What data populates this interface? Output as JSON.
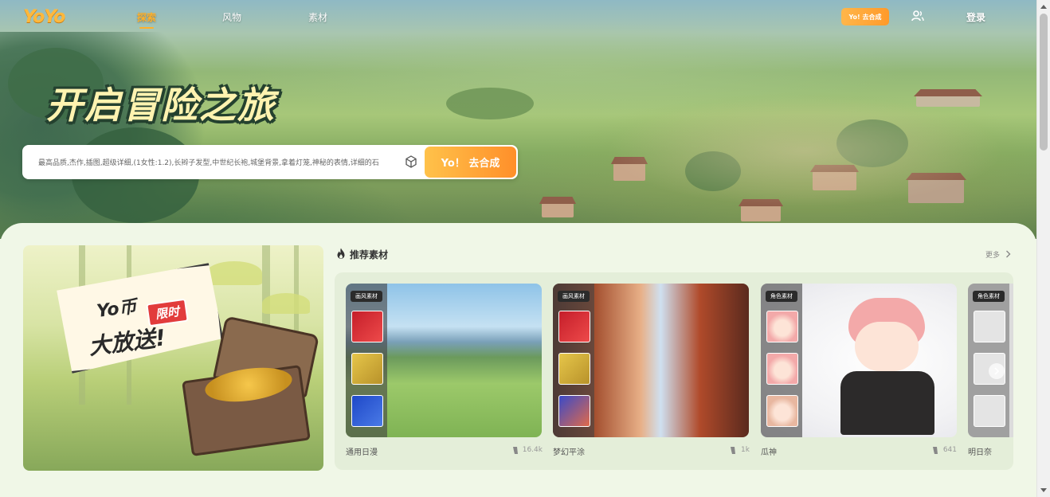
{
  "nav": {
    "logo": "YoYo",
    "links": [
      "探索",
      "风物",
      "素材"
    ],
    "active_index": 0,
    "cta_label": "Yo! 去合成",
    "login_label": "登录"
  },
  "hero": {
    "title": "开启冒险之旅",
    "prompt_text": "最高品质,杰作,插图,超级详细,(1女性:1.2),长辫子发型,中世纪长袍,城堡背景,拿着灯笼,神秘的表情,详细的石",
    "go_button": "Yo！ 去合成"
  },
  "promo": {
    "line1": "Yo币",
    "tag": "限时",
    "line2": "大放送!"
  },
  "recommend": {
    "title": "推荐素材",
    "more_label": "更多",
    "cards": [
      {
        "badge": "画风素材",
        "label": "通用日漫",
        "count": "16.4k"
      },
      {
        "badge": "画风素材",
        "label": "梦幻平涂",
        "count": "1k"
      },
      {
        "badge": "角色素材",
        "label": "瓜神",
        "count": "641"
      },
      {
        "badge": "角色素材",
        "label": "明日奈",
        "count": ""
      }
    ]
  },
  "colors": {
    "accent": "#ffa630",
    "panel_bg": "#f0f7e7",
    "carousel_bg": "#e4eed9"
  }
}
